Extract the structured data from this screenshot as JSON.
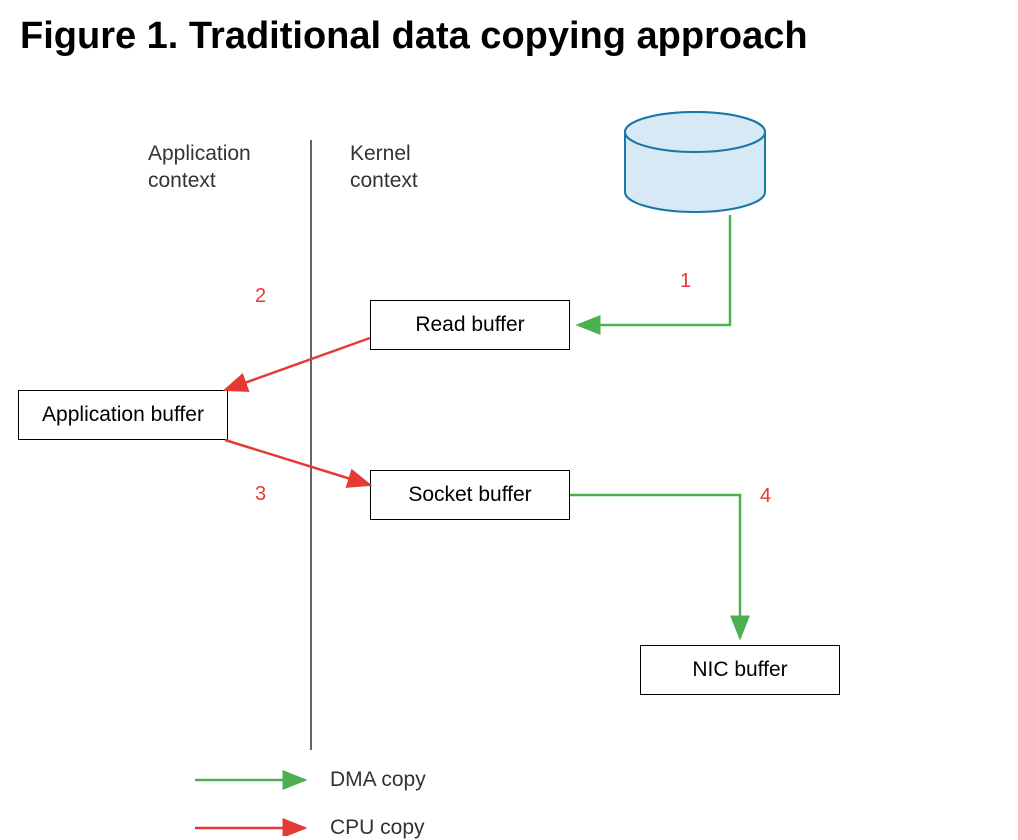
{
  "title": "Figure 1. Traditional data copying approach",
  "labels": {
    "appContext": "Application\ncontext",
    "kernelContext": "Kernel\ncontext"
  },
  "boxes": {
    "appBuffer": "Application buffer",
    "readBuffer": "Read buffer",
    "socketBuffer": "Socket buffer",
    "nicBuffer": "NIC buffer"
  },
  "steps": {
    "s1": "1",
    "s2": "2",
    "s3": "3",
    "s4": "4"
  },
  "legend": {
    "dma": "DMA copy",
    "cpu": "CPU copy"
  },
  "colors": {
    "green": "#4CAF50",
    "red": "#e53935",
    "cylinderFill": "#d6e9f4",
    "cylinderStroke": "#1976a8"
  }
}
